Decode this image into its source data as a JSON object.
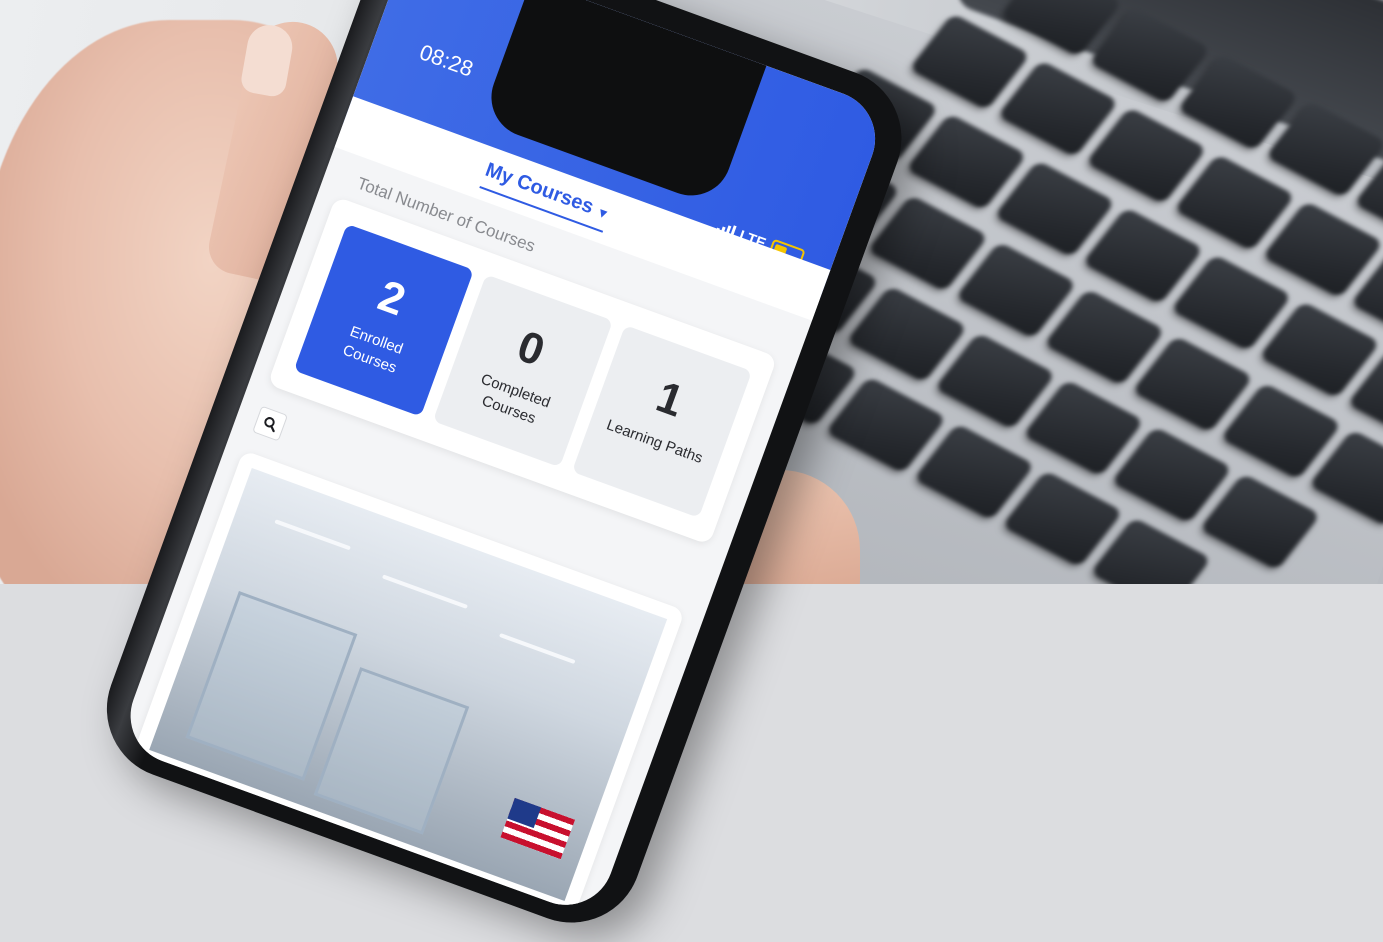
{
  "status_bar": {
    "time": "08:28",
    "signal_icon": "signal-bars-icon",
    "network": "LTE",
    "battery_icon": "battery-icon",
    "battery_color": "#f5c400"
  },
  "header": {
    "title": "My Courses",
    "caret_icon": "caret-down-icon",
    "color": "#2f5be3"
  },
  "summary": {
    "label": "Total Number of Courses",
    "stats": [
      {
        "value": "2",
        "label": "Enrolled Courses",
        "highlight": true
      },
      {
        "value": "0",
        "label": "Completed Courses",
        "highlight": false
      },
      {
        "value": "1",
        "label": "Learning Paths",
        "highlight": false
      }
    ]
  },
  "search": {
    "icon": "search-icon"
  },
  "course_card": {
    "image": "laboratory-photo",
    "badge": "us-flag-icon"
  }
}
